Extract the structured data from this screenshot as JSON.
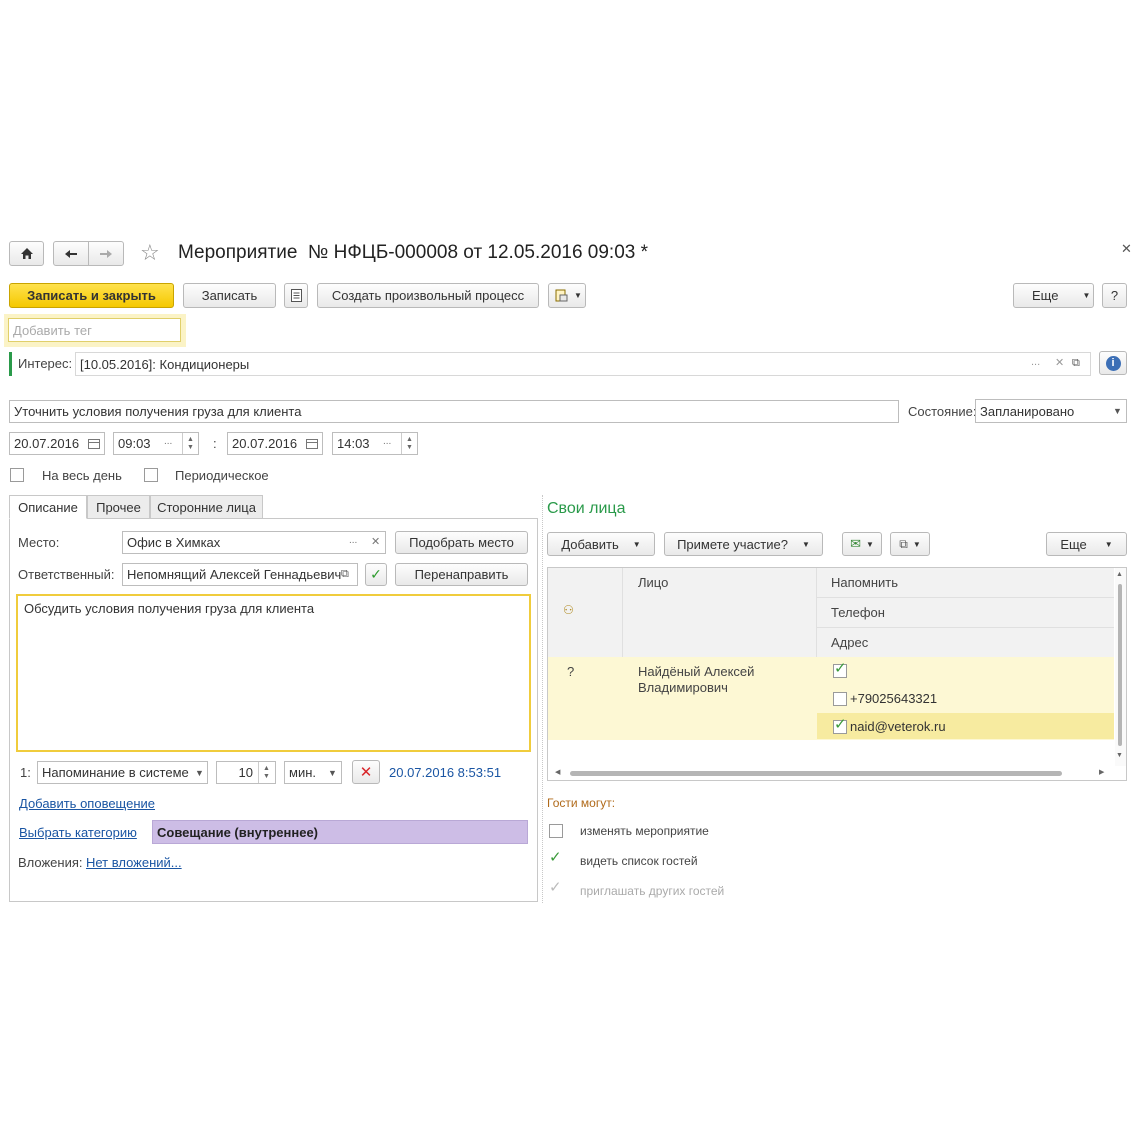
{
  "title": "Мероприятие  № НФЦБ-000008 от 12.05.2016 09:03 *",
  "toolbar": {
    "save_close": "Записать и закрыть",
    "save": "Записать",
    "create_process": "Создать произвольный процесс",
    "more": "Еще",
    "help": "?"
  },
  "tag_placeholder": "Добавить тег",
  "interest": {
    "label": "Интерес:",
    "value": "[10.05.2016]: Кондиционеры"
  },
  "subject": "Уточнить условия получения груза для клиента",
  "state": {
    "label": "Состояние:",
    "value": "Запланировано"
  },
  "dates": {
    "start_date": "20.07.2016",
    "start_time": "09:03",
    "separator": ":",
    "end_date": "20.07.2016",
    "end_time": "14:03"
  },
  "options": {
    "all_day": "На весь день",
    "periodic": "Периодическое"
  },
  "tabs": [
    "Описание",
    "Прочее",
    "Сторонние лица"
  ],
  "place": {
    "label": "Место:",
    "value": "Офис в Химках",
    "pick": "Подобрать место"
  },
  "responsible": {
    "label": "Ответственный:",
    "value": "Непомнящий Алексей Геннадьевич",
    "redirect": "Перенаправить"
  },
  "description": "Обсудить условия получения груза для клиента",
  "reminder": {
    "index": "1:",
    "type": "Напоминание в системе",
    "amount": "10",
    "unit": "мин.",
    "datetime": "20.07.2016 8:53:51"
  },
  "add_notification": "Добавить оповещение",
  "category": {
    "link": "Выбрать категорию",
    "value": "Совещание (внутреннее)",
    "color": "#cdbde6"
  },
  "attachments": {
    "label": "Вложения:",
    "value": "Нет вложений..."
  },
  "own_persons": {
    "title": "Свои лица",
    "add": "Добавить",
    "participate": "Примете участие?",
    "more": "Еще",
    "columns": {
      "person": "Лицо",
      "remind": "Напомнить",
      "phone": "Телефон",
      "address": "Адрес"
    },
    "rows": [
      {
        "status": "?",
        "name": "Найдёный Алексей Владимирович",
        "phone": "+79025643321",
        "email": "naid@veterok.ru"
      }
    ]
  },
  "guests": {
    "label": "Гости могут:",
    "items": [
      {
        "label": "изменять мероприятие",
        "checked": false
      },
      {
        "label": "видеть список гостей",
        "checked": true
      },
      {
        "label": "приглашать других гостей",
        "checked": true
      }
    ]
  },
  "colors": {
    "accent_green": "#2a9a4a",
    "primary": "#f5c800",
    "row_highlight": "#fdf8d4"
  }
}
